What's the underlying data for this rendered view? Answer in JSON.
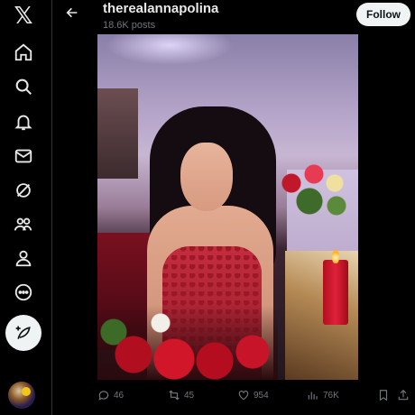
{
  "nav": {
    "logo": "𝕏",
    "items": [
      {
        "name": "home-icon"
      },
      {
        "name": "search-icon"
      },
      {
        "name": "bell-icon"
      },
      {
        "name": "mail-icon"
      },
      {
        "name": "grok-icon"
      },
      {
        "name": "communities-icon"
      },
      {
        "name": "profile-icon"
      },
      {
        "name": "more-icon"
      }
    ],
    "compose_icon": "feather-plus-icon"
  },
  "header": {
    "title": "therealannapolina",
    "subtitle": "18.6K posts",
    "follow_label": "Follow"
  },
  "actions": {
    "replies": "46",
    "reposts": "45",
    "likes": "954",
    "views": "76K"
  },
  "colors": {
    "background": "#000000",
    "text": "#e7e9ea",
    "muted": "#71767b",
    "button": "#eff3f4"
  }
}
